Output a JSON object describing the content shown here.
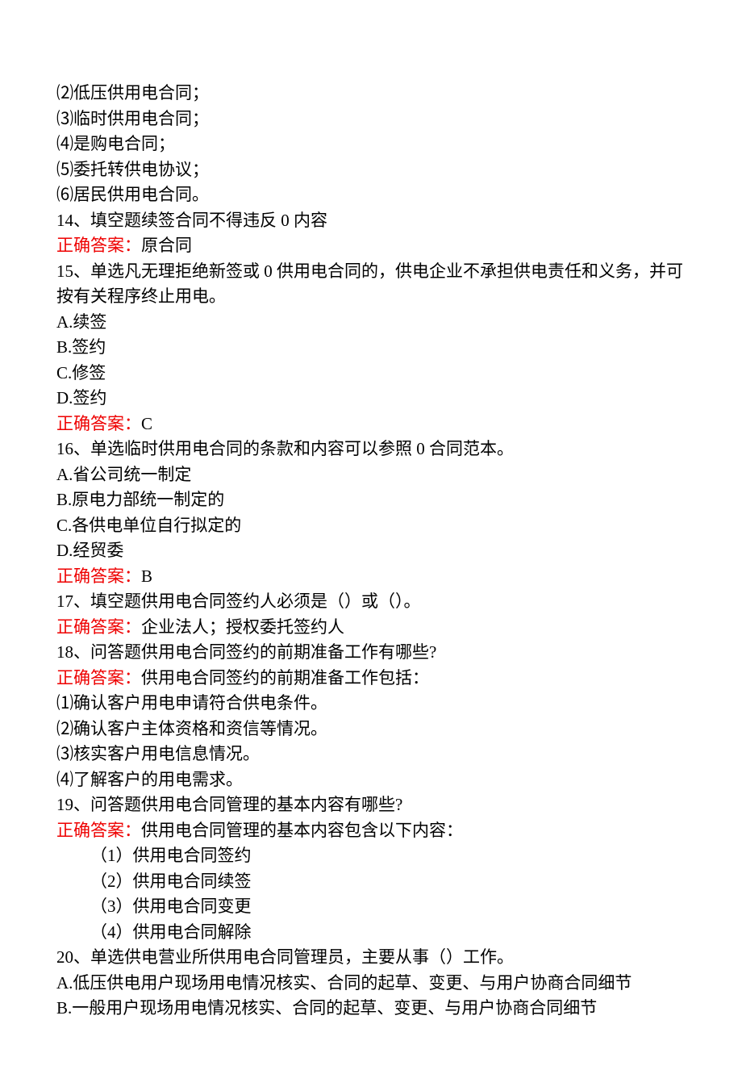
{
  "lines": [
    {
      "text": "⑵低压供用电合同；",
      "type": "plain"
    },
    {
      "text": "⑶临时供用电合同；",
      "type": "plain"
    },
    {
      "text": "⑷是购电合同；",
      "type": "plain"
    },
    {
      "text": "⑸委托转供电协议；",
      "type": "plain"
    },
    {
      "text": "⑹居民供用电合同。",
      "type": "plain"
    },
    {
      "text": "14、填空题续签合同不得违反 0 内容",
      "type": "plain"
    },
    {
      "label": "正确答案：",
      "text": "原合同",
      "type": "answer"
    },
    {
      "text": "15、单选凡无理拒绝新签或 0 供用电合同的，供电企业不承担供电责任和义务，并可按有关程序终止用电。",
      "type": "plain"
    },
    {
      "text": "A.续签",
      "type": "plain"
    },
    {
      "text": "B.签约",
      "type": "plain"
    },
    {
      "text": "C.修签",
      "type": "plain"
    },
    {
      "text": "D.签约",
      "type": "plain"
    },
    {
      "label": "正确答案：",
      "text": "C",
      "type": "answer"
    },
    {
      "text": "16、单选临时供用电合同的条款和内容可以参照 0 合同范本。",
      "type": "plain"
    },
    {
      "text": "A.省公司统一制定",
      "type": "plain"
    },
    {
      "text": "B.原电力部统一制定的",
      "type": "plain"
    },
    {
      "text": "C.各供电单位自行拟定的",
      "type": "plain"
    },
    {
      "text": "D.经贸委",
      "type": "plain"
    },
    {
      "label": "正确答案：",
      "text": "B",
      "type": "answer"
    },
    {
      "text": "17、填空题供用电合同签约人必须是（）或（）。",
      "type": "plain"
    },
    {
      "label": "正确答案：",
      "text": "企业法人；授权委托签约人",
      "type": "answer"
    },
    {
      "text": "18、问答题供用电合同签约的前期准备工作有哪些?",
      "type": "plain"
    },
    {
      "label": "正确答案：",
      "text": "供用电合同签约的前期准备工作包括：",
      "type": "answer"
    },
    {
      "text": "⑴确认客户用电申请符合供电条件。",
      "type": "plain"
    },
    {
      "text": "⑵确认客户主体资格和资信等情况。",
      "type": "plain"
    },
    {
      "text": "⑶核实客户用电信息情况。",
      "type": "plain"
    },
    {
      "text": "⑷了解客户的用电需求。",
      "type": "plain"
    },
    {
      "text": "19、问答题供用电合同管理的基本内容有哪些?",
      "type": "plain"
    },
    {
      "label": "正确答案：",
      "text": "供用电合同管理的基本内容包含以下内容：",
      "type": "answer"
    },
    {
      "text": "（1）供用电合同签约",
      "type": "indent"
    },
    {
      "text": "（2）供用电合同续签",
      "type": "indent"
    },
    {
      "text": "（3）供用电合同变更",
      "type": "indent"
    },
    {
      "text": "（4）供用电合同解除",
      "type": "indent"
    },
    {
      "text": "20、单选供电营业所供用电合同管理员，主要从事（）工作。",
      "type": "plain"
    },
    {
      "text": "A.低压供电用户现场用电情况核实、合同的起草、变更、与用户协商合同细节",
      "type": "plain"
    },
    {
      "text": "B.一般用户现场用电情况核实、合同的起草、变更、与用户协商合同细节",
      "type": "plain"
    }
  ]
}
